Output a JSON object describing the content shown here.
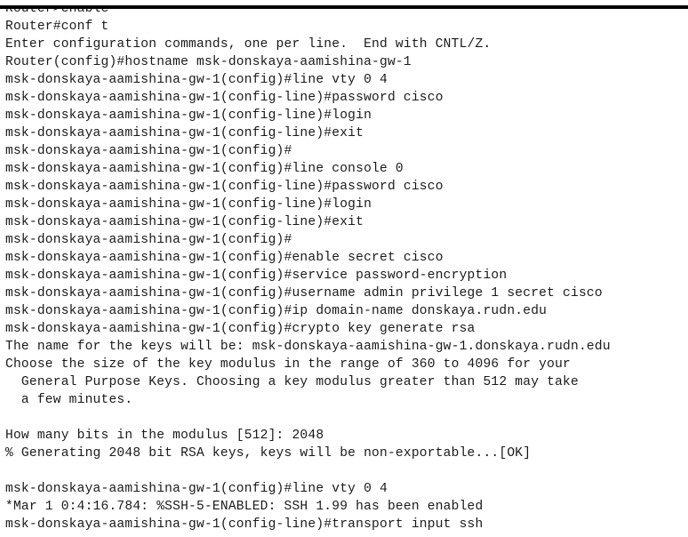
{
  "terminal": {
    "lines": [
      "Router>enable",
      "Router#conf t",
      "Enter configuration commands, one per line.  End with CNTL/Z.",
      "Router(config)#hostname msk-donskaya-aamishina-gw-1",
      "msk-donskaya-aamishina-gw-1(config)#line vty 0 4",
      "msk-donskaya-aamishina-gw-1(config-line)#password cisco",
      "msk-donskaya-aamishina-gw-1(config-line)#login",
      "msk-donskaya-aamishina-gw-1(config-line)#exit",
      "msk-donskaya-aamishina-gw-1(config)#",
      "msk-donskaya-aamishina-gw-1(config)#line console 0",
      "msk-donskaya-aamishina-gw-1(config-line)#password cisco",
      "msk-donskaya-aamishina-gw-1(config-line)#login",
      "msk-donskaya-aamishina-gw-1(config-line)#exit",
      "msk-donskaya-aamishina-gw-1(config)#",
      "msk-donskaya-aamishina-gw-1(config)#enable secret cisco",
      "msk-donskaya-aamishina-gw-1(config)#service password-encryption",
      "msk-donskaya-aamishina-gw-1(config)#username admin privilege 1 secret cisco",
      "msk-donskaya-aamishina-gw-1(config)#ip domain-name donskaya.rudn.edu",
      "msk-donskaya-aamishina-gw-1(config)#crypto key generate rsa",
      "The name for the keys will be: msk-donskaya-aamishina-gw-1.donskaya.rudn.edu",
      "Choose the size of the key modulus in the range of 360 to 4096 for your",
      "  General Purpose Keys. Choosing a key modulus greater than 512 may take",
      "  a few minutes.",
      "",
      "How many bits in the modulus [512]: 2048",
      "% Generating 2048 bit RSA keys, keys will be non-exportable...[OK]",
      "",
      "msk-donskaya-aamishina-gw-1(config)#line vty 0 4",
      "*Mar 1 0:4:16.784: %SSH-5-ENABLED: SSH 1.99 has been enabled",
      "msk-donskaya-aamishina-gw-1(config-line)#transport input ssh"
    ]
  }
}
